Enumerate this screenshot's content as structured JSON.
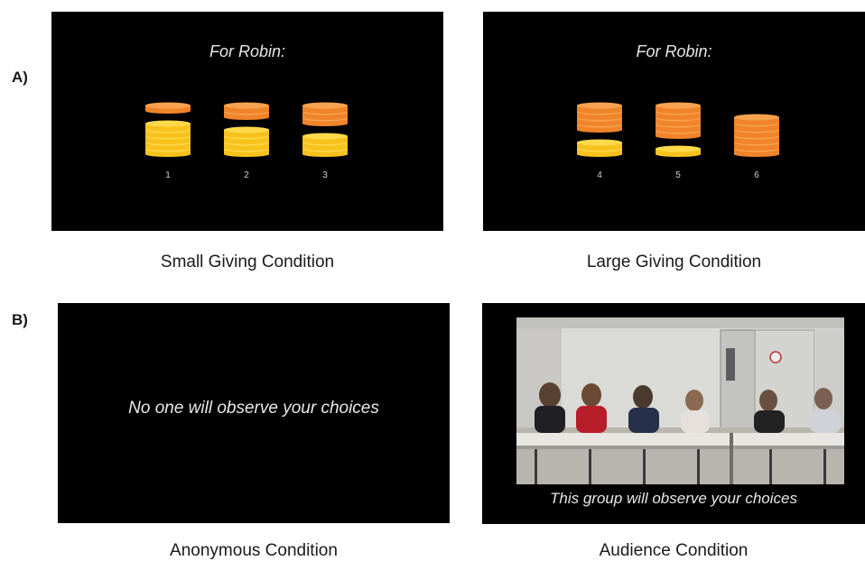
{
  "section_labels": {
    "a": "A)",
    "b": "B)"
  },
  "panel_a": {
    "small": {
      "heading": "For Robin:",
      "options": [
        {
          "number": "1",
          "orange_coins": 1,
          "yellow_coins": 5
        },
        {
          "number": "2",
          "orange_coins": 2,
          "yellow_coins": 4
        },
        {
          "number": "3",
          "orange_coins": 3,
          "yellow_coins": 3
        }
      ],
      "caption": "Small Giving Condition"
    },
    "large": {
      "heading": "For Robin:",
      "options": [
        {
          "number": "4",
          "orange_coins": 4,
          "yellow_coins": 2
        },
        {
          "number": "5",
          "orange_coins": 5,
          "yellow_coins": 1
        },
        {
          "number": "6",
          "orange_coins": 6,
          "yellow_coins": 0
        }
      ],
      "caption": "Large Giving Condition"
    }
  },
  "panel_b": {
    "anonymous": {
      "message": "No one will observe your choices",
      "caption": "Anonymous Condition"
    },
    "audience": {
      "message": "This group will observe your choices",
      "caption": "Audience Condition",
      "photo_description": "six-children-seated-at-table"
    }
  },
  "colors": {
    "panel_bg": "#000000",
    "coin_orange": "#f0842a",
    "coin_orange_rim": "#f7a24e",
    "coin_yellow": "#f7c21d",
    "coin_yellow_rim": "#ffd94a"
  }
}
